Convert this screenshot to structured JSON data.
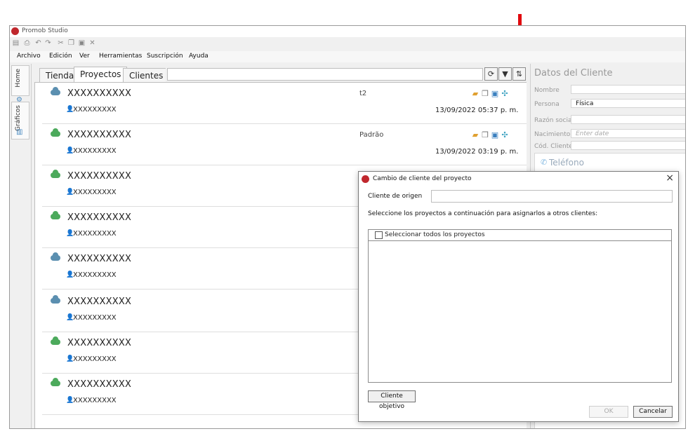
{
  "window": {
    "title": "Promob Studio"
  },
  "toolbar": {
    "icons": [
      "save-icon",
      "print-icon",
      "undo-icon",
      "redo-icon",
      "cut-icon",
      "copy-icon",
      "paste-icon",
      "delete-icon"
    ]
  },
  "menu": [
    "Archivo",
    "Edición",
    "Ver",
    "Herramientas",
    "Suscripción",
    "Ayuda"
  ],
  "side_tabs": [
    {
      "label": "Home"
    },
    {
      "label": "Gráficos"
    }
  ],
  "tabs": [
    {
      "label": "Tienda"
    },
    {
      "label": "Proyectos",
      "active": true
    },
    {
      "label": "Clientes"
    }
  ],
  "search": {
    "value": ""
  },
  "projects": [
    {
      "name": "XXXXXXXXXX",
      "client": "XXXXXXXXX",
      "tree": "t2",
      "date": "13/09/2022 05:37 p. m.",
      "cloud_color": "#5b8fb0"
    },
    {
      "name": "XXXXXXXXXX",
      "client": "XXXXXXXXX",
      "tree": "Padrão",
      "date": "13/09/2022 03:19 p. m.",
      "cloud_color": "#4caa5c"
    },
    {
      "name": "XXXXXXXXXX",
      "client": "XXXXXXXXX",
      "tree": "",
      "date": "",
      "cloud_color": "#4caa5c"
    },
    {
      "name": "XXXXXXXXXX",
      "client": "XXXXXXXXX",
      "tree": "",
      "date": "",
      "cloud_color": "#4caa5c"
    },
    {
      "name": "XXXXXXXXXX",
      "client": "XXXXXXXXX",
      "tree": "",
      "date": "",
      "cloud_color": "#5b8fb0"
    },
    {
      "name": "XXXXXXXXXX",
      "client": "XXXXXXXXX",
      "tree": "",
      "date": "",
      "cloud_color": "#5b8fb0"
    },
    {
      "name": "XXXXXXXXXX",
      "client": "XXXXXXXXX",
      "tree": "",
      "date": "",
      "cloud_color": "#4caa5c"
    },
    {
      "name": "XXXXXXXXXX",
      "client": "XXXXXXXXX",
      "tree": "",
      "date": "",
      "cloud_color": "#4caa5c"
    }
  ],
  "right_panel": {
    "title": "Datos del Cliente",
    "fields": [
      {
        "label": "Nombre",
        "value": ""
      },
      {
        "label": "Persona",
        "value": "Física"
      },
      {
        "label": "Razón social",
        "value": ""
      },
      {
        "label": "Nacimiento",
        "value": "Enter date"
      },
      {
        "label": "Cód. Cliente",
        "value": ""
      }
    ],
    "phone_label": "Teléfono"
  },
  "dialog": {
    "title": "Cambio de cliente del proyecto",
    "origin_label": "Cliente de origen",
    "origin_value": "",
    "instruction": "Seleccione los proyectos a continuación para asignarlos a otros clientes:",
    "select_all": "Seleccionar todos los proyectos",
    "target_button": "Cliente objetivo",
    "ok": "OK",
    "cancel": "Cancelar"
  },
  "colors": {
    "accent_red": "#e1090e",
    "logo_red": "#c0272d",
    "cloud_blue": "#5b8fb0",
    "cloud_green": "#4caa5c"
  }
}
